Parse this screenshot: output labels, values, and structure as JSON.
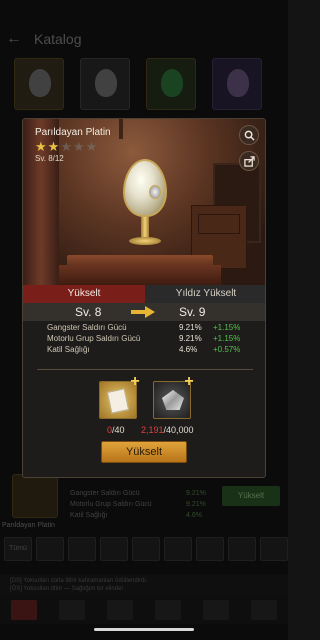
{
  "background": {
    "title": "Katalog",
    "item_name": "Parıldayan Platin",
    "stats": [
      "Gangster Saldırı Gücü",
      "Motorlu Grup Saldırı Gücü",
      "Katil Sağlığı"
    ],
    "stat_values": [
      "9.21%",
      "9.21%",
      "4.6%"
    ],
    "upgrade_label": "Yükselt",
    "filter_first": "Tümü",
    "chat_line_1": "[DS] Yoksulları zorla ittirir kahramanları ödüllendirdi.",
    "chat_line_2": "[ÖS] Yoksulları ittirir — Sağlığım bir elinde!",
    "nav_labels": [
      "",
      "Setler",
      "Geliştir",
      "Kahraman",
      "Mağaza",
      "Kulüp"
    ]
  },
  "modal": {
    "item_name": "Parıldayan Platin",
    "stars_filled": 2,
    "stars_total": 5,
    "level_text": "Sv. 8/12",
    "tabs": [
      {
        "label": "Yükselt",
        "active": true
      },
      {
        "label": "Yıldız Yükselt",
        "active": false
      }
    ],
    "current_level": "Sv. 8",
    "next_level": "Sv. 9",
    "stats": [
      {
        "label": "Gangster Saldırı Gücü",
        "value": "9.21%",
        "bonus": "+1.15%"
      },
      {
        "label": "Motorlu Grup Saldırı Gücü",
        "value": "9.21%",
        "bonus": "+1.15%"
      },
      {
        "label": "Katil Sağlığı",
        "value": "4.6%",
        "bonus": "+0.57%"
      }
    ],
    "materials": [
      {
        "icon": "document-icon",
        "have": "0",
        "need": "/40"
      },
      {
        "icon": "diamond-icon",
        "have": "2,191",
        "need": "/40,000"
      }
    ],
    "upgrade_label": "Yükselt"
  },
  "colors": {
    "accent_gold": "#e0a43a",
    "tab_active": "#7a1e1a",
    "bonus_green": "#52c24a",
    "insufficient_red": "#e04040"
  }
}
